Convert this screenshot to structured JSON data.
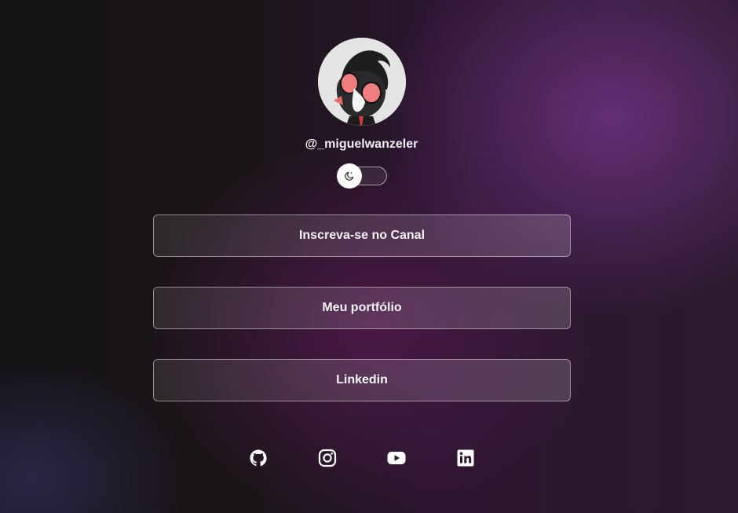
{
  "profile": {
    "username": "@_miguelwanzeler",
    "avatar_icon": "cartoon-character-avatar"
  },
  "theme_toggle": {
    "icon": "moon-stars-icon",
    "state": "dark"
  },
  "links": [
    {
      "label": "Inscreva-se no Canal"
    },
    {
      "label": "Meu portfólio"
    },
    {
      "label": "Linkedin"
    }
  ],
  "socials": [
    {
      "icon": "github-icon"
    },
    {
      "icon": "instagram-icon"
    },
    {
      "icon": "youtube-icon"
    },
    {
      "icon": "linkedin-icon"
    }
  ],
  "colors": {
    "text": "#ffffff",
    "accent_purple": "#6e3282",
    "background_dark": "#151316"
  }
}
